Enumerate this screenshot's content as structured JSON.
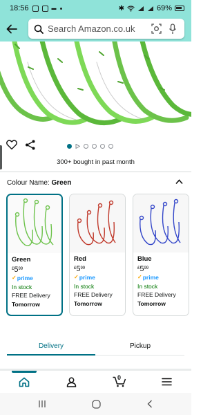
{
  "status_bar": {
    "time": "18:56",
    "battery": "69%"
  },
  "search": {
    "placeholder": "Search Amazon.co.uk"
  },
  "icons": {
    "back": "back-arrow-icon",
    "camera": "camera-lens-icon",
    "mic": "microphone-icon",
    "wishlist": "heart-icon",
    "share": "share-icon",
    "expand": "chevron-up-icon"
  },
  "product": {
    "bought_text": "300+ bought in past month",
    "image_count": 6,
    "active_image_index": 0
  },
  "colour": {
    "label": "Colour Name:",
    "selected": "Green"
  },
  "variants": [
    {
      "name": "Green",
      "price_currency": "£",
      "price_whole": "5",
      "price_fraction": "99",
      "prime": "prime",
      "stock": "In stock",
      "delivery": "FREE Delivery",
      "delivery_day": "Tomorrow",
      "color": "#6cc24a",
      "selected": true
    },
    {
      "name": "Red",
      "price_currency": "£",
      "price_whole": "5",
      "price_fraction": "99",
      "prime": "prime",
      "stock": "In stock",
      "delivery": "FREE Delivery",
      "delivery_day": "Tomorrow",
      "color": "#c0392b",
      "selected": false
    },
    {
      "name": "Blue",
      "price_currency": "£",
      "price_whole": "5",
      "price_fraction": "99",
      "prime": "prime",
      "stock": "In stock",
      "delivery": "FREE Delivery",
      "delivery_day": "Tomorrow",
      "color": "#3346c9",
      "selected": false
    }
  ],
  "tabs": {
    "delivery": "Delivery",
    "pickup": "Pickup",
    "active": "Delivery"
  },
  "bottom_nav": {
    "cart_count": "0",
    "active": "home"
  },
  "colors": {
    "header": "#8fe3d9",
    "accent": "#007185",
    "prime_blue": "#1a98ff",
    "in_stock": "#007600"
  }
}
